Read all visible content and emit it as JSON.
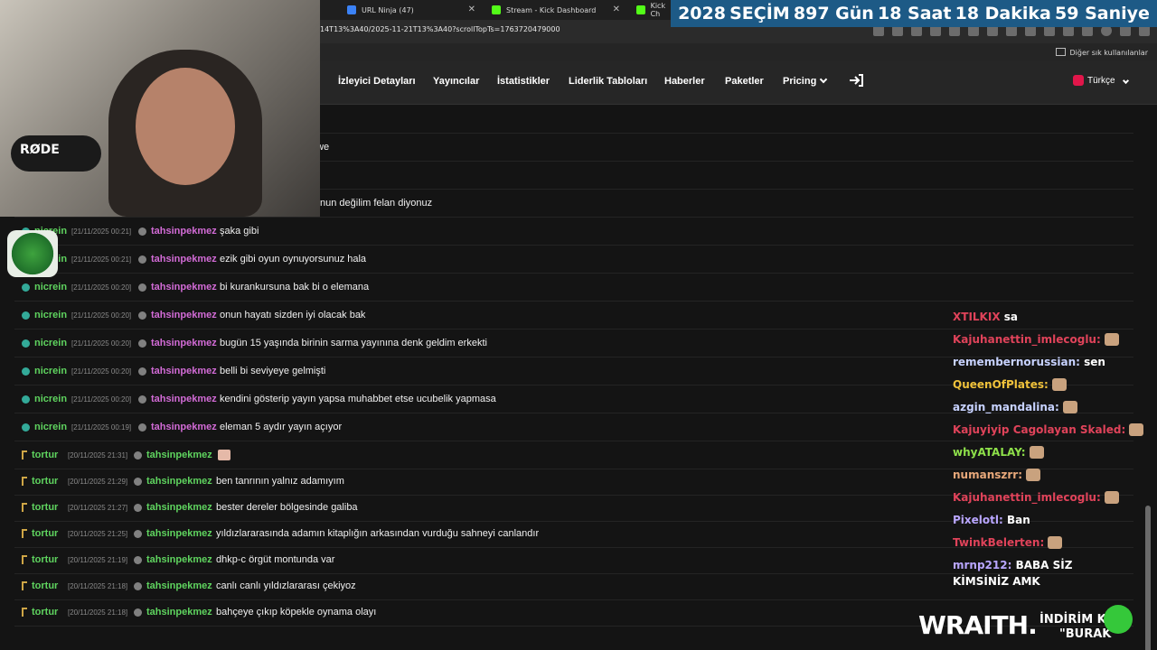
{
  "browser": {
    "tabs": [
      {
        "title": "URL Ninja (47)",
        "fav": "#3b82f6"
      },
      {
        "title": "Stream - Kick Dashboard",
        "fav": "#53fc18"
      },
      {
        "title": "Kick Ch",
        "fav": "#53fc18"
      }
    ],
    "url": "14T13%3A40/2025-11-21T13%3A40?scrollTopTs=1763720479000",
    "bookmarks_label": "Diğer sık kullanılanlar"
  },
  "countdown": {
    "year": "2028",
    "title": "SEÇİM",
    "days": "897 Gün",
    "hours": "18 Saat",
    "minutes": "18 Dakika",
    "seconds": "59 Saniye"
  },
  "nav": {
    "items": [
      "İzleyici Detayları",
      "Yayıncılar",
      "İstatistikler",
      "Liderlik Tabloları",
      "Haberler",
      "Paketler"
    ],
    "pricing": "Pricing",
    "language": "Türkçe"
  },
  "partial": {
    "line1": "we",
    "line2": "nun değilim felan diyonuz"
  },
  "messages": [
    {
      "channel": "nicrein",
      "time": "[21/11/2025 00:21]",
      "user": "tahsinpekmez",
      "text": "şaka gibi"
    },
    {
      "channel": "nicrein",
      "time": "[21/11/2025 00:21]",
      "user": "tahsinpekmez",
      "text": "ezik gibi oyun oynuyorsunuz hala"
    },
    {
      "channel": "nicrein",
      "time": "[21/11/2025 00:20]",
      "user": "tahsinpekmez",
      "text": "bi kurankursuna bak bi o elemana"
    },
    {
      "channel": "nicrein",
      "time": "[21/11/2025 00:20]",
      "user": "tahsinpekmez",
      "text": "onun hayatı sizden iyi olacak bak"
    },
    {
      "channel": "nicrein",
      "time": "[21/11/2025 00:20]",
      "user": "tahsinpekmez",
      "text": "bugün 15 yaşında birinin sarma yayınına denk geldim erkekti"
    },
    {
      "channel": "nicrein",
      "time": "[21/11/2025 00:20]",
      "user": "tahsinpekmez",
      "text": "belli bi seviyeye gelmişti"
    },
    {
      "channel": "nicrein",
      "time": "[21/11/2025 00:20]",
      "user": "tahsinpekmez",
      "text": "kendini gösterip yayın yapsa muhabbet etse ucubelik yapmasa"
    },
    {
      "channel": "nicrein",
      "time": "[21/11/2025 00:19]",
      "user": "tahsinpekmez",
      "text": "eleman 5 aydır yayın açıyor"
    },
    {
      "channel": "tortur",
      "time": "[20/11/2025 21:31]",
      "user": "tahsinpekmez",
      "text": ""
    },
    {
      "channel": "tortur",
      "time": "[20/11/2025 21:29]",
      "user": "tahsinpekmez",
      "text": "ben tanrının yalnız adamıyım"
    },
    {
      "channel": "tortur",
      "time": "[20/11/2025 21:27]",
      "user": "tahsinpekmez",
      "text": "bester dereler bölgesinde galiba"
    },
    {
      "channel": "tortur",
      "time": "[20/11/2025 21:25]",
      "user": "tahsinpekmez",
      "text": "yıldızlararasında adamın kitaplığın arkasından vurduğu sahneyi canlandır"
    },
    {
      "channel": "tortur",
      "time": "[20/11/2025 21:19]",
      "user": "tahsinpekmez",
      "text": "dhkp-c örgüt montunda var"
    },
    {
      "channel": "tortur",
      "time": "[20/11/2025 21:18]",
      "user": "tahsinpekmez",
      "text": "canlı canlı yıldızlararası çekiyoz"
    },
    {
      "channel": "tortur",
      "time": "[20/11/2025 21:18]",
      "user": "tahsinpekmez",
      "text": "bahçeye çıkıp köpekle oynama olayı"
    }
  ],
  "webcam_brand": "RØDE",
  "overlay_chat": [
    {
      "user": "XTILKIX",
      "text": "sa",
      "color": "#e0435a"
    },
    {
      "user": "Kajuhanettin_imlecoglu:",
      "text": "",
      "color": "#e0435a"
    },
    {
      "user": "remembernorussian:",
      "text": "sen",
      "color": "#c7d2ff"
    },
    {
      "user": "QueenOfPlates:",
      "text": "",
      "color": "#f0c23b"
    },
    {
      "user": "azgin_mandalina:",
      "text": "",
      "color": "#c7d2ff"
    },
    {
      "user": "Kajuyiyip Cagolayan Skaled:",
      "text": "",
      "color": "#e0435a"
    },
    {
      "user": "whyATALAY:",
      "text": "",
      "color": "#8ee04a"
    },
    {
      "user": "numanszrr:",
      "text": "",
      "color": "#e8a87a"
    },
    {
      "user": "Kajuhanettin_imlecoglu:",
      "text": "",
      "color": "#e0435a"
    },
    {
      "user": "Pixelotl:",
      "text": "Ban",
      "color": "#b9a6ff"
    },
    {
      "user": "TwinkBelerten:",
      "text": "",
      "color": "#e0435a"
    },
    {
      "user": "mrnp212:",
      "text": "BABA SİZ",
      "color": "#b9a6ff"
    },
    {
      "user": "",
      "text": "KİMSİNİZ AMK",
      "color": "#ffffff"
    }
  ],
  "sponsor": {
    "brand": "WRAITH.",
    "promo_line1": "İNDİRİM KO",
    "promo_line2": "\"BURAK"
  }
}
